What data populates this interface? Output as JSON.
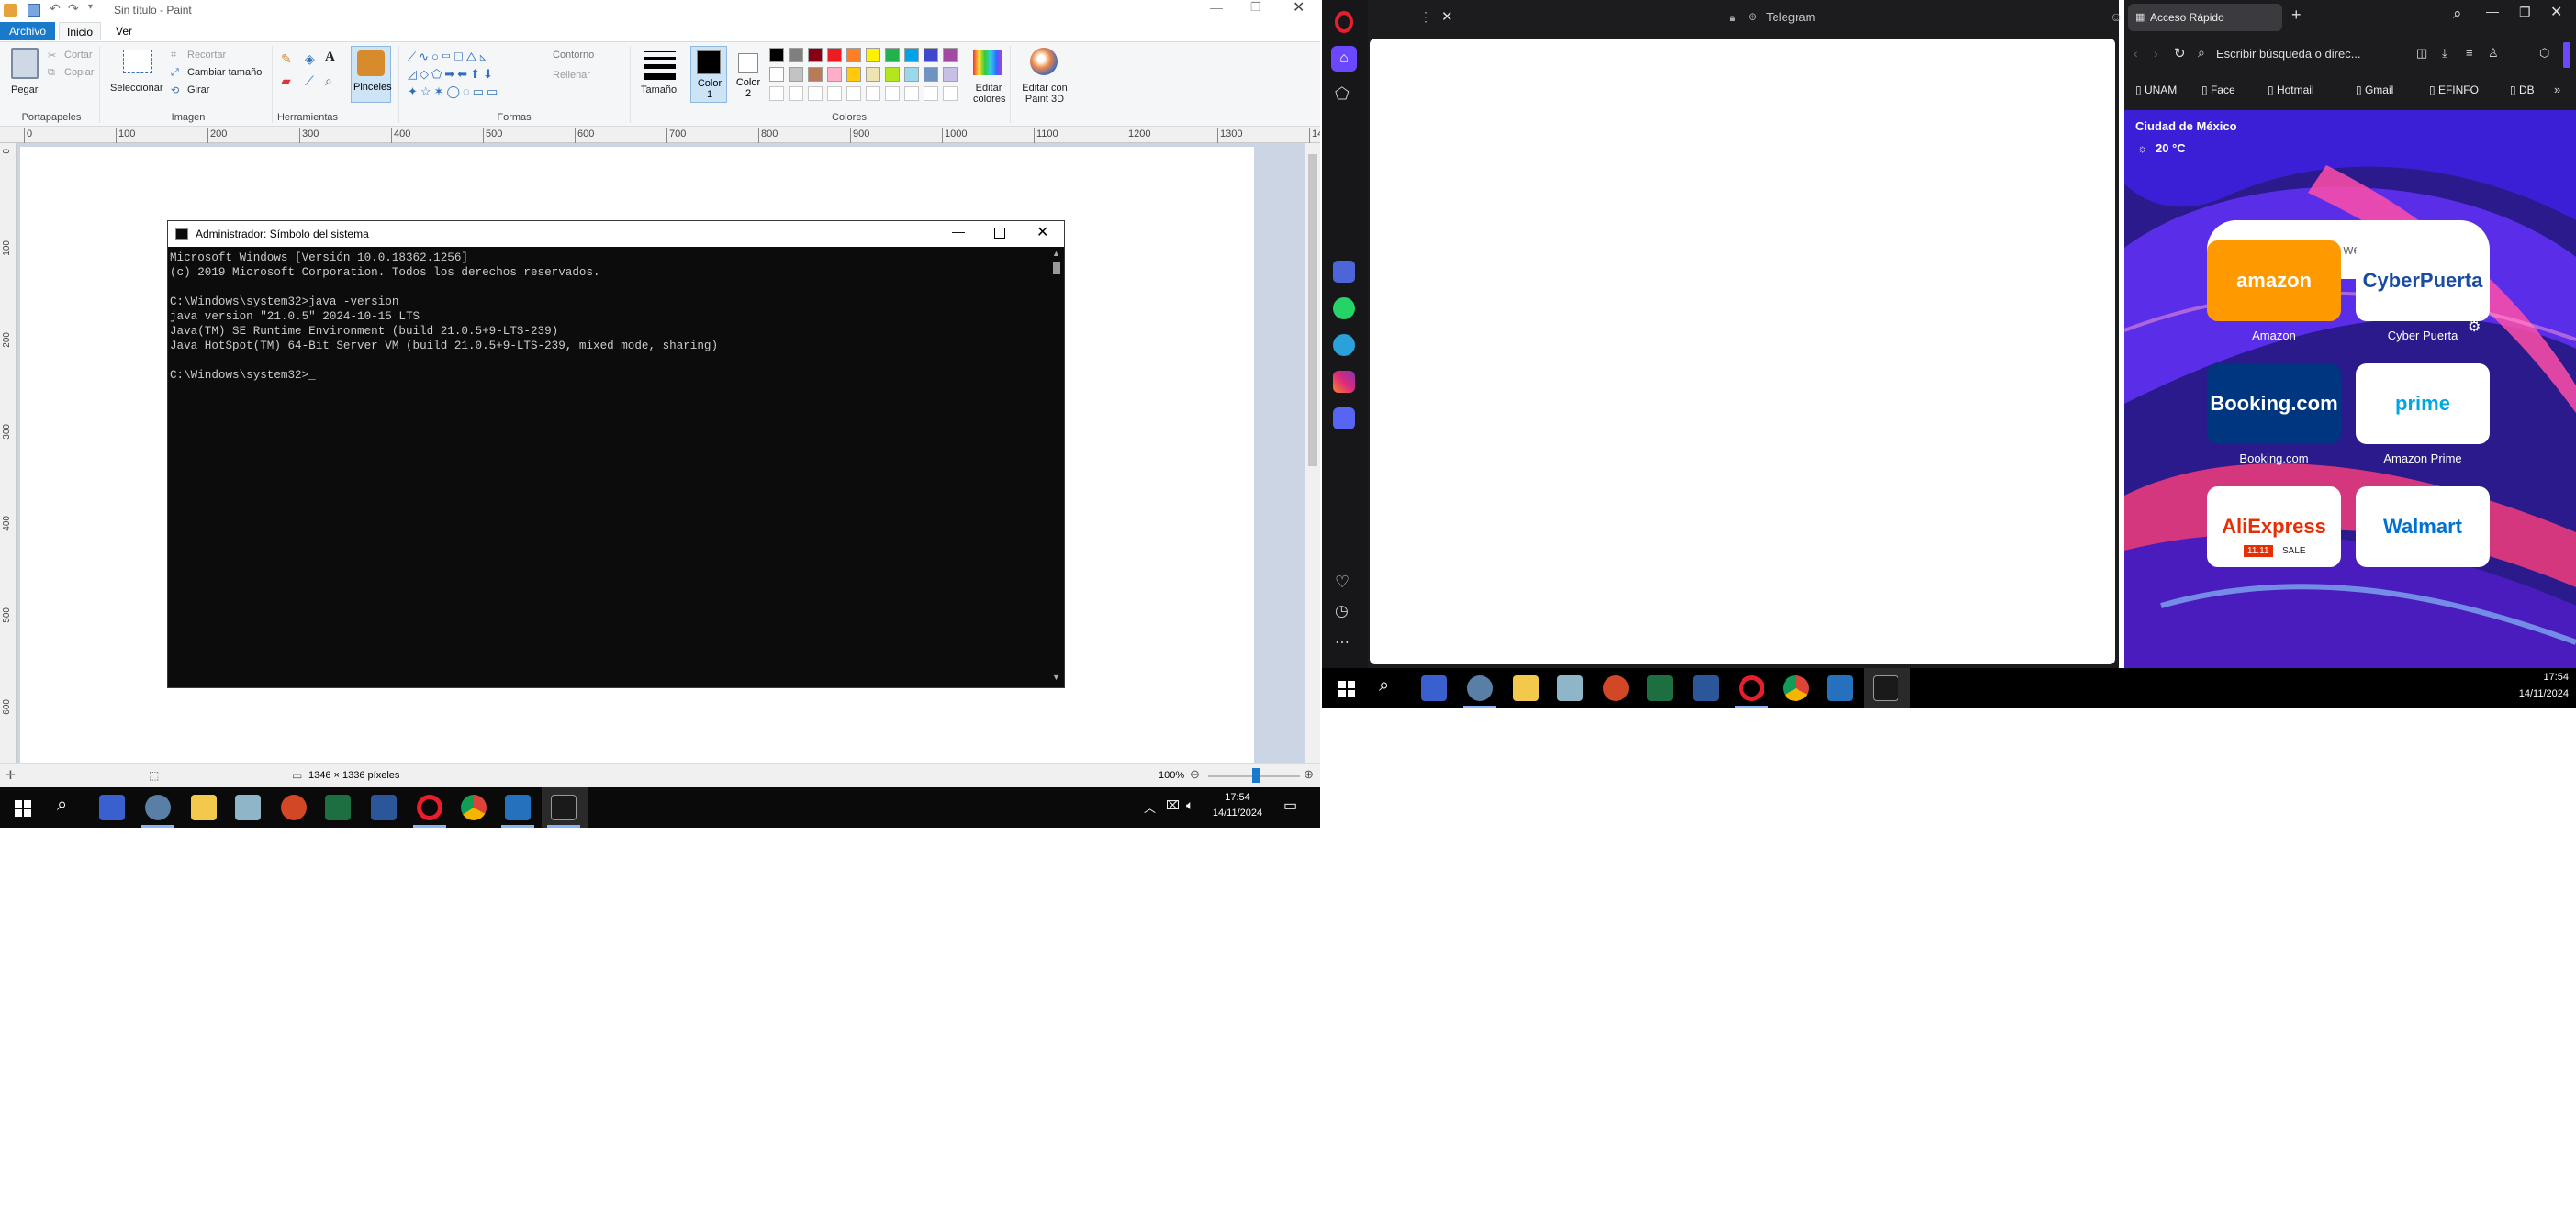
{
  "paint": {
    "title": "Sin título - Paint",
    "menu": {
      "file": "Archivo",
      "home": "Inicio",
      "view": "Ver"
    },
    "clipboard": {
      "paste": "Pegar",
      "cut": "Cortar",
      "copy": "Copiar",
      "group": "Portapapeles"
    },
    "image": {
      "select": "Seleccionar",
      "crop": "Recortar",
      "resize": "Cambiar tamaño",
      "rotate": "Girar",
      "group": "Imagen"
    },
    "tools": {
      "group": "Herramientas",
      "brushes": "Pinceles"
    },
    "shapes": {
      "outline": "Contorno",
      "fill": "Rellenar",
      "group": "Formas"
    },
    "size": "Tamaño",
    "color1": "Color 1",
    "color2": "Color 2",
    "edit_colors": "Editar colores",
    "edit_paint3d": "Editar con Paint 3D",
    "colors_group": "Colores",
    "palette_row1": [
      "#000000",
      "#7f7f7f",
      "#880015",
      "#ed1c24",
      "#ff7f27",
      "#fff200",
      "#22b14c",
      "#00a2e8",
      "#3f48cc",
      "#a349a4"
    ],
    "palette_row2": [
      "#ffffff",
      "#c3c3c3",
      "#b97a57",
      "#ffaec9",
      "#ffc90e",
      "#efe4b0",
      "#b5e61d",
      "#99d9ea",
      "#7092be",
      "#c8bfe7"
    ],
    "ruler_labels": [
      "0",
      "100",
      "200",
      "300",
      "400",
      "500",
      "600",
      "700",
      "800",
      "900",
      "1000",
      "1100",
      "1200",
      "1300",
      "14"
    ],
    "vruler_labels": [
      "0",
      "100",
      "200",
      "300",
      "400",
      "500",
      "600"
    ],
    "status": {
      "dimensions": "1346 × 1336 píxeles",
      "zoom": "100%"
    }
  },
  "cmd": {
    "title": "Administrador: Símbolo del sistema",
    "lines": [
      "Microsoft Windows [Versión 10.0.18362.1256]",
      "(c) 2019 Microsoft Corporation. Todos los derechos reservados.",
      "",
      "C:\\Windows\\system32>java -version",
      "java version \"21.0.5\" 2024-10-15 LTS",
      "Java(TM) SE Runtime Environment (build 21.0.5+9-LTS-239)",
      "Java HotSpot(TM) 64-Bit Server VM (build 21.0.5+9-LTS-239, mixed mode, sharing)",
      "",
      "C:\\Windows\\system32>_"
    ]
  },
  "taskbar_left": {
    "time": "17:54",
    "date": "14/11/2024"
  },
  "taskbar_right": {
    "time": "17:54",
    "date": "14/11/2024"
  },
  "telegram": {
    "title": "Telegram"
  },
  "speed_dial": {
    "tab_title": "Acceso Rápido",
    "address_placeholder": "Escribir búsqueda o direc...",
    "bookmarks": [
      "UNAM",
      "Face",
      "Hotmail",
      "Gmail",
      "EFINFO",
      "DB"
    ],
    "weather_city": "Ciudad de México",
    "weather_temp": "20 °C",
    "search_placeholder": "Busca en la web",
    "tiles": [
      {
        "label": "Amazon",
        "logo": "amazon",
        "color": "#ff9900"
      },
      {
        "label": "Cyber Puerta",
        "logo": "CyberPuerta",
        "color": "#ffffff"
      },
      {
        "label": "Booking.com",
        "logo": "Booking.com",
        "color": "#003580"
      },
      {
        "label": "Amazon Prime",
        "logo": "prime",
        "color": "#ffffff"
      },
      {
        "label": "AliExpress",
        "logo": "AliExpress",
        "color": "#ffffff"
      },
      {
        "label": "Walmart",
        "logo": "Walmart",
        "color": "#ffffff"
      }
    ],
    "ali_badge": "11.11",
    "ali_sale": "SALE"
  }
}
